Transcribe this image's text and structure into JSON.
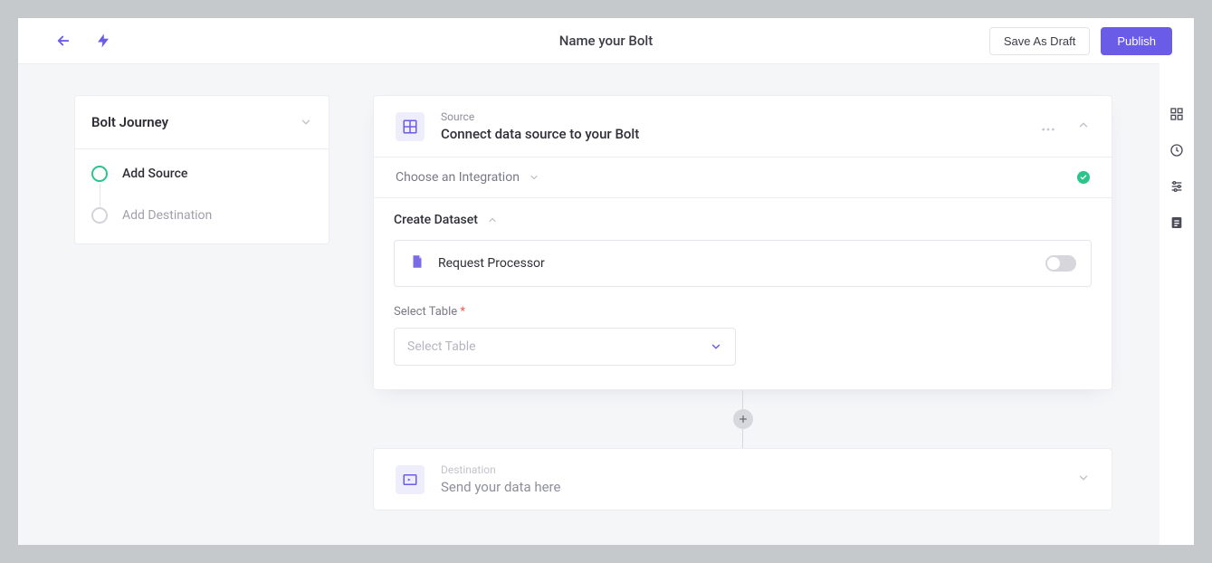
{
  "topbar": {
    "title": "Name your Bolt",
    "draft_label": "Save As Draft",
    "publish_label": "Publish"
  },
  "journey": {
    "title": "Bolt Journey",
    "steps": [
      {
        "label": "Add Source",
        "active": true
      },
      {
        "label": "Add Destination",
        "active": false
      }
    ]
  },
  "source_panel": {
    "kicker": "Source",
    "heading": "Connect data source to your Bolt",
    "integration_row_label": "Choose an Integration",
    "dataset_title": "Create Dataset",
    "request_processor_label": "Request Processor",
    "select_table_label": "Select Table",
    "select_table_placeholder": "Select Table"
  },
  "destination_panel": {
    "kicker": "Destination",
    "heading": "Send your data here"
  },
  "colors": {
    "primary": "#6b5ce7",
    "success": "#2bc48a"
  }
}
